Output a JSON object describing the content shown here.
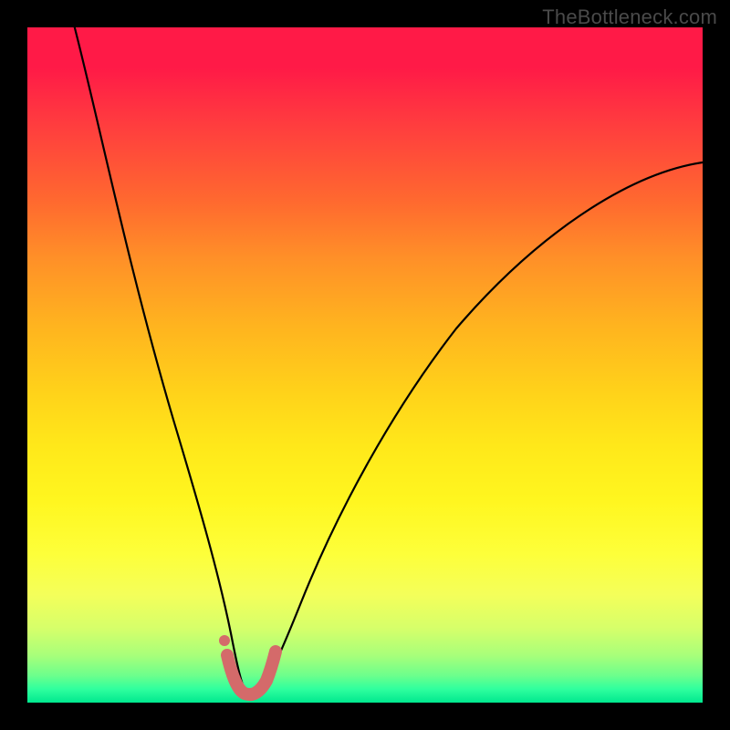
{
  "watermark": "TheBottleneck.com",
  "chart_data": {
    "type": "line",
    "title": "",
    "xlabel": "",
    "ylabel": "",
    "xlim": [
      0,
      100
    ],
    "ylim": [
      0,
      100
    ],
    "grid": false,
    "legend": false,
    "series": [
      {
        "name": "bottleneck-curve",
        "color": "#000000",
        "x": [
          7,
          10,
          14,
          18,
          22,
          25,
          27,
          29,
          30.5,
          31.5,
          32.5,
          34,
          36,
          38,
          42,
          48,
          56,
          66,
          78,
          90,
          100
        ],
        "values": [
          100,
          86,
          70,
          54,
          38,
          25,
          16,
          9,
          4,
          1.5,
          1.5,
          3,
          7,
          12,
          21,
          33,
          46,
          58,
          68,
          75,
          80
        ]
      },
      {
        "name": "highlight-band",
        "color": "#d46a6a",
        "x": [
          29.5,
          30.2,
          31.0,
          32.0,
          33.0,
          34.0,
          35.0,
          35.8
        ],
        "values": [
          6.0,
          3.0,
          1.5,
          1.2,
          1.2,
          1.8,
          3.5,
          6.5
        ]
      },
      {
        "name": "highlight-dot",
        "color": "#d46a6a",
        "x": [
          29.2
        ],
        "values": [
          8.5
        ]
      }
    ],
    "background_gradient": {
      "direction": "vertical",
      "stops": [
        {
          "pos": 0.0,
          "color": "#ff1a47"
        },
        {
          "pos": 0.3,
          "color": "#ff7a2a"
        },
        {
          "pos": 0.55,
          "color": "#ffd21a"
        },
        {
          "pos": 0.8,
          "color": "#fdff3a"
        },
        {
          "pos": 0.93,
          "color": "#a8ff7a"
        },
        {
          "pos": 1.0,
          "color": "#00e88f"
        }
      ]
    }
  }
}
